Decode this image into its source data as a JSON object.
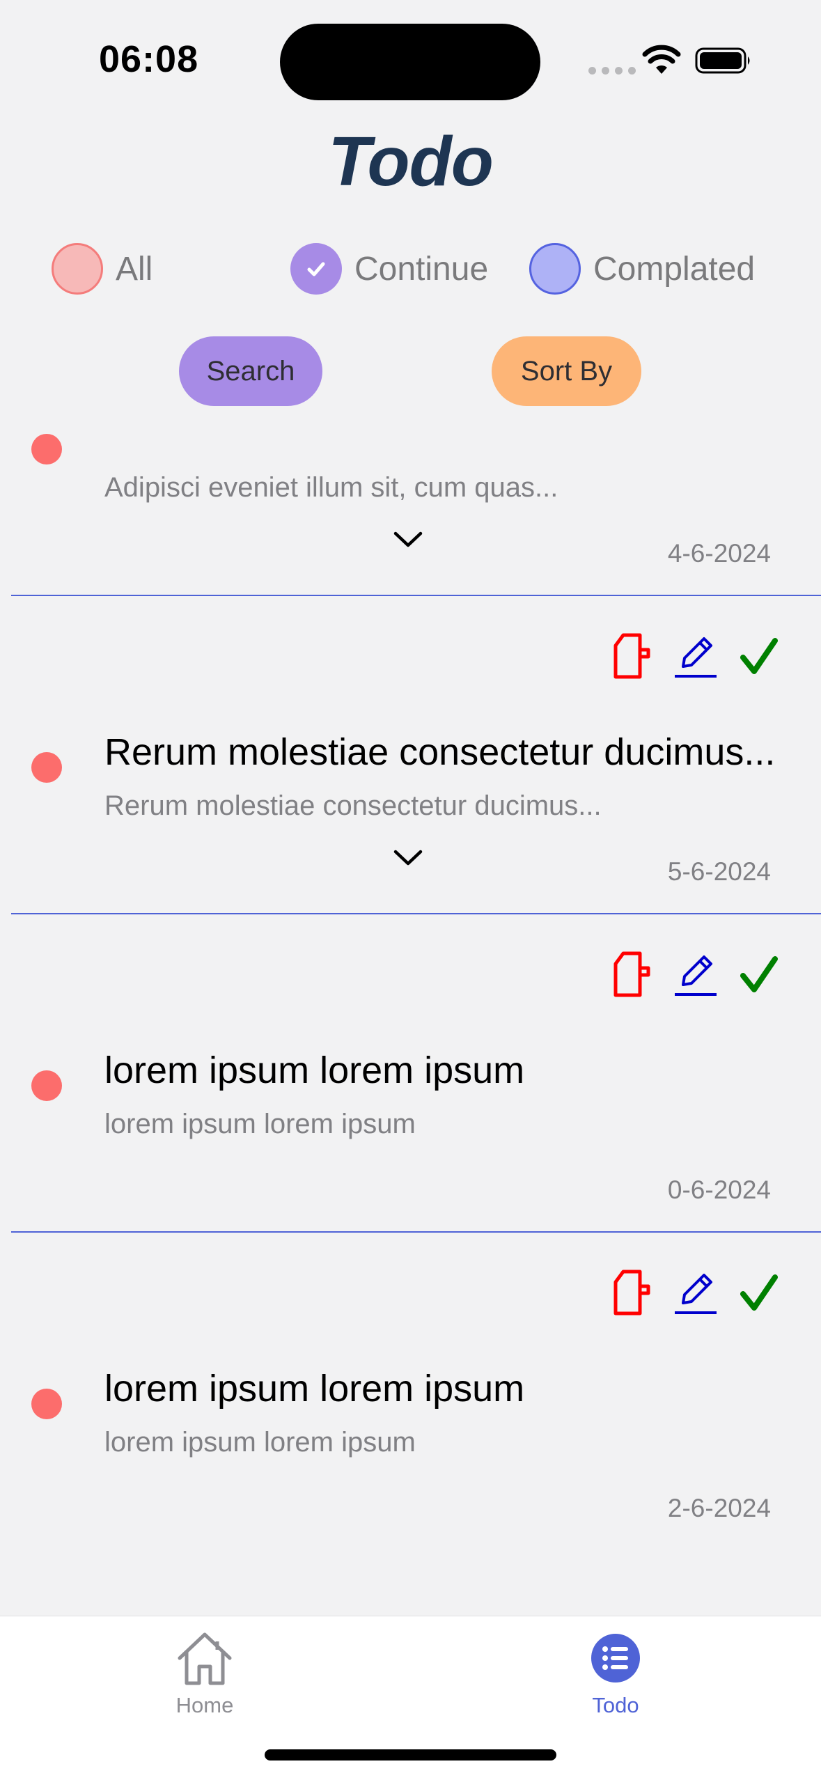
{
  "status": {
    "time": "06:08"
  },
  "header": {
    "title": "Todo"
  },
  "filters": [
    {
      "label": "All",
      "checked": false,
      "color": "#f7b9b8",
      "border": "#f47c7b"
    },
    {
      "label": "Continue",
      "checked": true,
      "color": "#a78be6",
      "border": "#a78be6"
    },
    {
      "label": "Complated",
      "checked": false,
      "color": "#aeb2f6",
      "border": "#5563e0"
    }
  ],
  "buttons": {
    "search": "Search",
    "sort": "Sort By"
  },
  "todos": [
    {
      "title": "",
      "description": "Adipisci eveniet illum sit, cum quas...",
      "date": "4-6-2024",
      "expandable": true
    },
    {
      "title": "Rerum molestiae consectetur ducimus...",
      "description": "Rerum molestiae consectetur ducimus...",
      "date": "5-6-2024",
      "expandable": true
    },
    {
      "title": "lorem ipsum lorem ipsum",
      "description": "lorem ipsum lorem ipsum",
      "date": "0-6-2024",
      "expandable": false
    },
    {
      "title": "lorem ipsum lorem ipsum",
      "description": "lorem ipsum lorem ipsum",
      "date": "2-6-2024",
      "expandable": false
    }
  ],
  "icons": {
    "delete": "delete-file-icon",
    "edit": "pencil-edit-icon",
    "complete": "checkmark-icon"
  },
  "colors": {
    "delete": "#ff0000",
    "edit": "#0000cc",
    "complete": "#008000",
    "accent": "#4f63d6",
    "bullet": "#fc6d6c"
  },
  "tabbar": {
    "home": "Home",
    "todo": "Todo",
    "active": "Todo"
  }
}
